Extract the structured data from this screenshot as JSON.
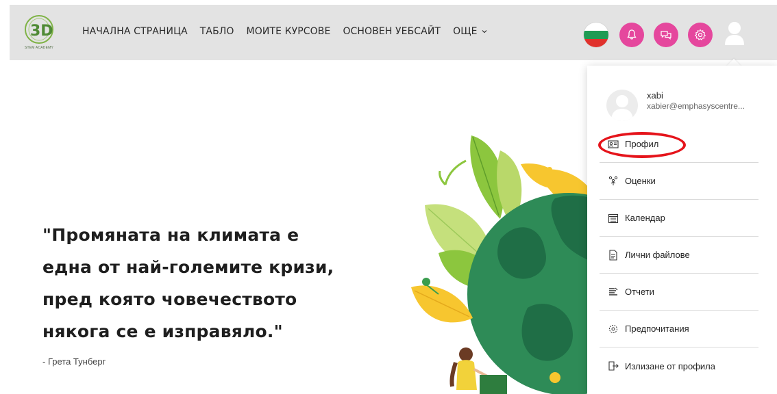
{
  "brand": {
    "logo_text": "3D",
    "logo_subtext": "STEM ACADEMY",
    "accent_color": "#e5479d",
    "navbar_bg": "#e3e3e3"
  },
  "nav": {
    "links": [
      "НАЧАЛНА СТРАНИЦА",
      "ТАБЛО",
      "МОИТЕ КУРСОВЕ",
      "ОСНОВЕН УЕБСАЙТ"
    ],
    "more_label": "ОЩЕ"
  },
  "actions": {
    "language_flag": "bulgaria-flag-icon",
    "notifications_icon": "bell-icon",
    "messages_icon": "chat-icon",
    "settings_icon": "gear-icon",
    "user_icon": "user-icon"
  },
  "hero": {
    "quote_lines": [
      "\"Промяната на климата е",
      "една от най-големите кризи,",
      "пред която човечеството",
      "някога се е изправяло.\""
    ],
    "author": "- Грета Тунберг"
  },
  "user_menu": {
    "name": "xabi",
    "email": "xabier@emphasyscentre...",
    "items": [
      {
        "label": "Профил",
        "icon": "profile-card-icon"
      },
      {
        "label": "Оценки",
        "icon": "grades-icon"
      },
      {
        "label": "Календар",
        "icon": "calendar-icon"
      },
      {
        "label": "Лични файлове",
        "icon": "file-icon"
      },
      {
        "label": "Отчети",
        "icon": "reports-icon"
      },
      {
        "label": "Предпочитания",
        "icon": "preferences-gear-icon"
      },
      {
        "label": "Излизане от профила",
        "icon": "logout-icon"
      }
    ],
    "highlighted_item": "Профил",
    "highlight_color": "#e5141b"
  }
}
